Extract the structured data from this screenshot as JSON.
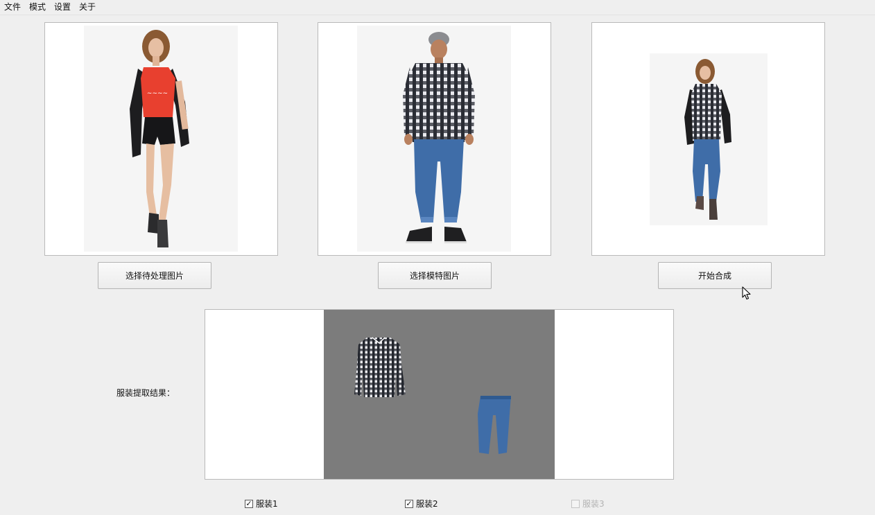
{
  "menubar": {
    "items": [
      {
        "label": "文件"
      },
      {
        "label": "模式"
      },
      {
        "label": "设置"
      },
      {
        "label": "关于"
      }
    ]
  },
  "panels": {
    "source": {
      "button_label": "选择待处理图片"
    },
    "model": {
      "button_label": "选择模特图片"
    },
    "result": {
      "button_label": "开始合成"
    }
  },
  "extraction": {
    "label": "服装提取结果："
  },
  "checkboxes": [
    {
      "label": "服装1",
      "checked": true,
      "enabled": true
    },
    {
      "label": "服装2",
      "checked": true,
      "enabled": true
    },
    {
      "label": "服装3",
      "checked": false,
      "enabled": false
    }
  ],
  "colors": {
    "window_bg": "#efefef",
    "extraction_bg": "#7c7c7c",
    "plaid_dark": "#2a2d35",
    "denim": "#3f6da8"
  }
}
